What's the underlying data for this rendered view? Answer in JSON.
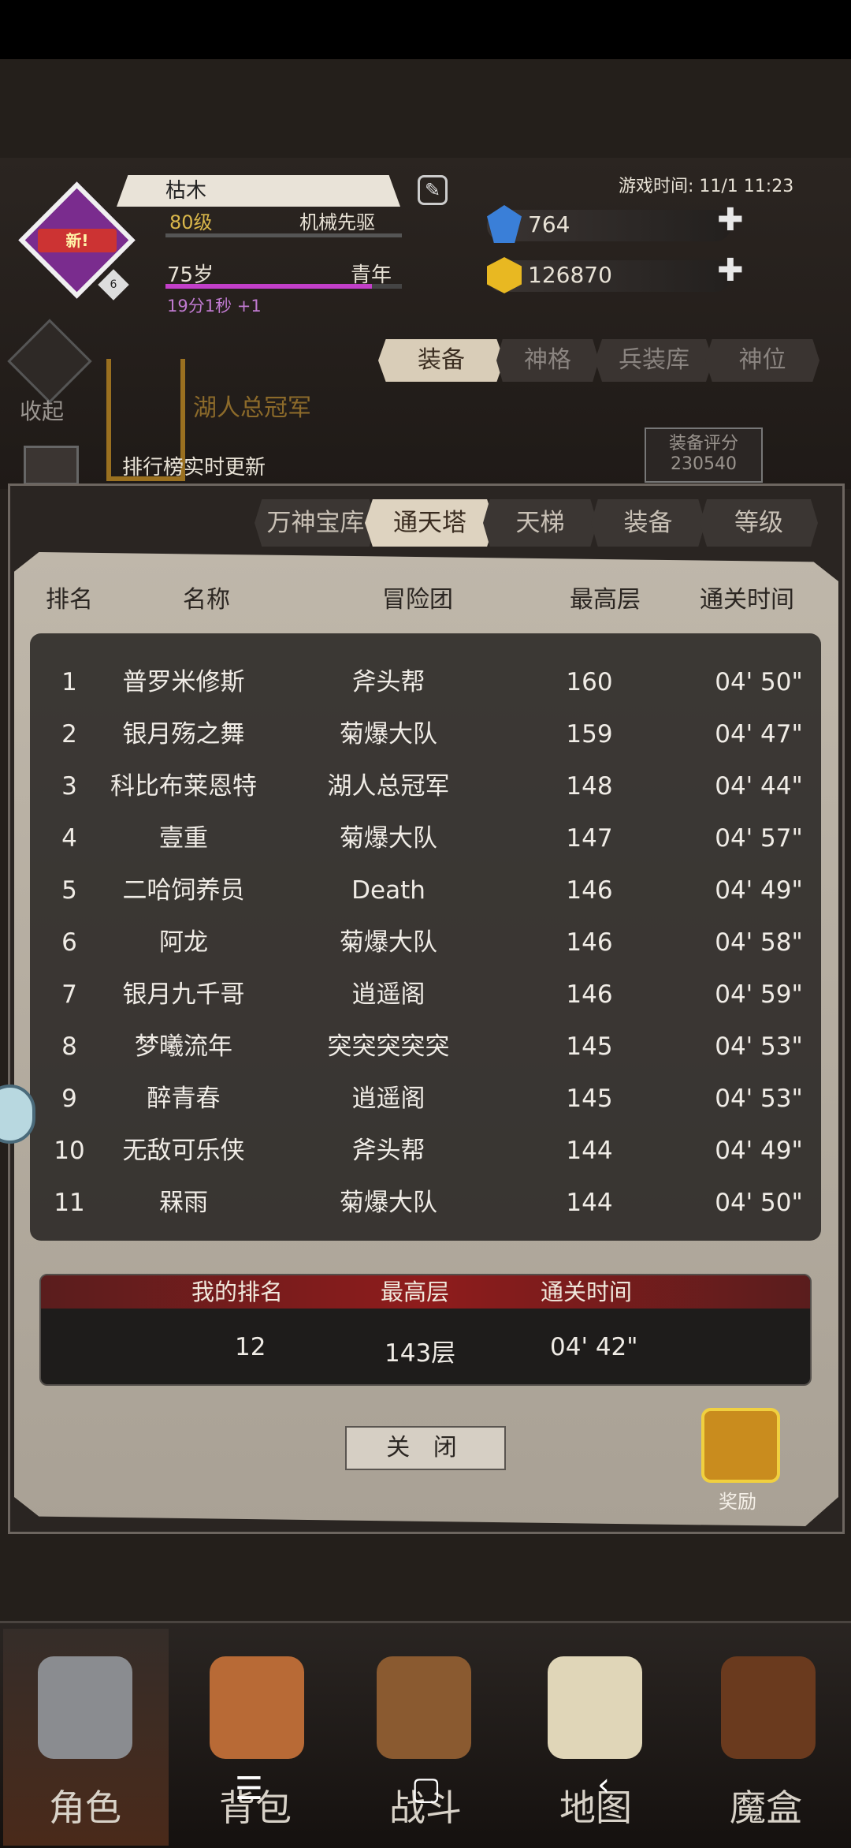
{
  "player": {
    "name": "枯木",
    "badge": "新!",
    "badge_level": "6",
    "level": "80级",
    "class": "机械先驱",
    "age": "75岁",
    "stage": "青年",
    "timer": "19分1秒 +1"
  },
  "game_time": "游戏时间: 11/1 11:23",
  "currency": {
    "gems": "764",
    "gold": "126870",
    "plus": "✚"
  },
  "collapse_label": "收起",
  "top_tabs": [
    "装备",
    "神格",
    "兵装库",
    "神位"
  ],
  "banner": {
    "champion": "湖人总冠军",
    "live": "排行榜实时更新"
  },
  "score": {
    "label": "装备评分",
    "value": "230540"
  },
  "rank_tabs": [
    "万神宝库",
    "通天塔",
    "天梯",
    "装备",
    "等级"
  ],
  "columns": [
    "排名",
    "名称",
    "冒险团",
    "最高层",
    "通关时间"
  ],
  "rows": [
    {
      "rank": "1",
      "name": "普罗米修斯",
      "team": "斧头帮",
      "floor": "160",
      "time": "04' 50\""
    },
    {
      "rank": "2",
      "name": "银月殇之舞",
      "team": "菊爆大队",
      "floor": "159",
      "time": "04' 47\""
    },
    {
      "rank": "3",
      "name": "科比布莱恩特",
      "team": "湖人总冠军",
      "floor": "148",
      "time": "04' 44\""
    },
    {
      "rank": "4",
      "name": "壹重",
      "team": "菊爆大队",
      "floor": "147",
      "time": "04' 57\""
    },
    {
      "rank": "5",
      "name": "二哈饲养员",
      "team": "Death",
      "floor": "146",
      "time": "04' 49\""
    },
    {
      "rank": "6",
      "name": "阿龙",
      "team": "菊爆大队",
      "floor": "146",
      "time": "04' 58\""
    },
    {
      "rank": "7",
      "name": "银月九千哥",
      "team": "逍遥阁",
      "floor": "146",
      "time": "04' 59\""
    },
    {
      "rank": "8",
      "name": "梦曦流年",
      "team": "突突突突突",
      "floor": "145",
      "time": "04' 53\""
    },
    {
      "rank": "9",
      "name": "醉青春",
      "team": "逍遥阁",
      "floor": "145",
      "time": "04' 53\""
    },
    {
      "rank": "10",
      "name": "无敌可乐侠",
      "team": "斧头帮",
      "floor": "144",
      "time": "04' 49\""
    },
    {
      "rank": "11",
      "name": "槑雨",
      "team": "菊爆大队",
      "floor": "144",
      "time": "04' 50\""
    }
  ],
  "my_rank": {
    "headers": [
      "我的排名",
      "最高层",
      "通关时间"
    ],
    "rank": "12",
    "floor": "143层",
    "time": "04' 42\""
  },
  "close_label": "关 闭",
  "reward_label": "奖励",
  "nav": [
    "角色",
    "背包",
    "战斗",
    "地图",
    "魔盒"
  ],
  "sys_nav": {
    "menu": "☰",
    "home": "▢",
    "back": "‹"
  },
  "colors": {
    "accent_purple": "#c23fc8",
    "gold_text": "#d8b64a",
    "my_rank_red": "#8f1c1c"
  }
}
